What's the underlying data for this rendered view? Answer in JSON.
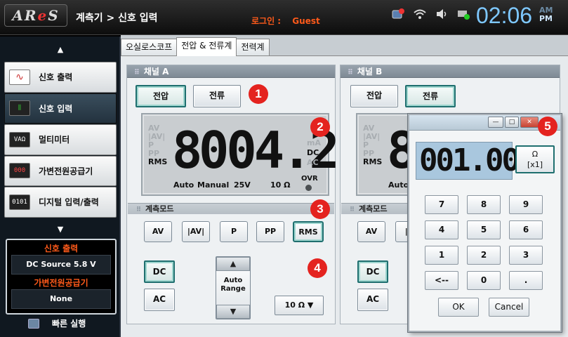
{
  "app": {
    "logo": {
      "a": "AR",
      "e": "e",
      "s": "S"
    },
    "breadcrumb": "계측기 > 신호 입력",
    "login_label": "로그인 :",
    "login_user": "Guest",
    "clock": "02:06",
    "am": "AM",
    "pm": "PM",
    "pm_active": true,
    "status_icons": [
      "network-badge-icon",
      "wifi-icon",
      "speaker-icon",
      "device-check-icon"
    ]
  },
  "sidebar": {
    "scroll_up": "▲",
    "scroll_down": "▼",
    "items": [
      {
        "label": "신호 출력",
        "icon": "∿",
        "icon_name": "signal-output-icon",
        "active": false
      },
      {
        "label": "신호 입력",
        "icon": "⫼",
        "icon_name": "signal-input-icon",
        "active": true
      },
      {
        "label": "멀티미터",
        "icon": "VAΩ",
        "icon_name": "multimeter-icon",
        "active": false
      },
      {
        "label": "가변전원공급기",
        "icon": "000",
        "icon_name": "power-supply-icon",
        "active": false
      },
      {
        "label": "디지털 입력/출력",
        "icon": "0101",
        "icon_name": "digital-io-icon",
        "active": false
      }
    ],
    "quick_status": {
      "signal_output_title": "신호 출력",
      "signal_output_value": "DC Source 5.8 V",
      "power_supply_title": "가변전원공급기",
      "power_supply_value": "None"
    },
    "quick_run_label": "빠른 실행"
  },
  "tabs": [
    {
      "label": "오실로스코프",
      "active": false
    },
    {
      "label": "전압 & 전류계",
      "active": true
    },
    {
      "label": "전력계",
      "active": false
    }
  ],
  "channel_a": {
    "title": "채널 A",
    "voltage_button": "전압",
    "current_button": "전류",
    "selected_type": "voltage",
    "left_labels": [
      "AV",
      "|AV|",
      "P",
      "PP",
      "RMS"
    ],
    "active_left_label": "RMS",
    "digits_ghost": "8",
    "digits": "004.2",
    "units": [
      "mA",
      "DC",
      "AC"
    ],
    "active_units": [
      "DC"
    ],
    "auto": "Auto",
    "manual": "Manual",
    "voltage_range": "25V",
    "ohm_range": "10 Ω",
    "ovr": "OVR",
    "mode_title": "계측모드",
    "modes": [
      "AV",
      "|AV|",
      "P",
      "PP",
      "RMS"
    ],
    "selected_mode": "RMS",
    "dc_button": "DC",
    "ac_button": "AC",
    "range_up": "▲",
    "range_label_1": "Auto",
    "range_label_2": "Range",
    "range_down": "▼",
    "ohm_select": "10 Ω ▼"
  },
  "channel_b": {
    "title": "채널 B",
    "voltage_button": "전압",
    "current_button": "전류",
    "selected_type": "current",
    "left_labels": [
      "AV",
      "|AV|",
      "P",
      "PP",
      "RMS"
    ],
    "digits_ghost": "8",
    "auto": "Auto",
    "mode_title": "계측모드",
    "modes": [
      "AV",
      "|A"
    ],
    "dc_button": "DC",
    "ac_button": "AC"
  },
  "keypad": {
    "display": "001.00",
    "unit_line1": "Ω",
    "unit_line2": "[x1]",
    "minimize": "—",
    "maximize": "□",
    "close": "✕",
    "keys": [
      "7",
      "8",
      "9",
      "4",
      "5",
      "6",
      "1",
      "2",
      "3",
      "<--",
      "0",
      "."
    ],
    "ok": "OK",
    "cancel": "Cancel"
  },
  "callouts": [
    "1",
    "2",
    "3",
    "4",
    "5"
  ],
  "colors": {
    "accent_red": "#e4231f",
    "login_orange": "#ff5a1a",
    "clock_blue": "#7ec8ff",
    "selected_border": "#1f6f6f"
  }
}
